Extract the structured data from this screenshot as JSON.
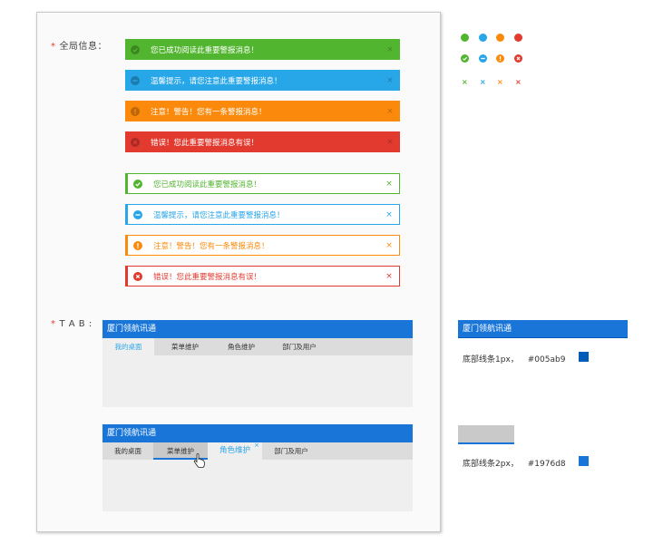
{
  "colors": {
    "success": "#52b52f",
    "info": "#27a6e8",
    "warning": "#fb8a0c",
    "error": "#e23a2f",
    "tab_accent": "#1976d8",
    "tab_underline": "#005ab9",
    "tab_active_text": "#2ea6e8"
  },
  "global_info": {
    "label": "全局信息：",
    "alerts": [
      {
        "type": "success",
        "text": "您已成功阅读此重要警报消息！",
        "icon": "check-circle-icon",
        "close": "×"
      },
      {
        "type": "info",
        "text": "温馨提示，请您注意此重要警报消息！",
        "icon": "minus-circle-icon",
        "close": "×"
      },
      {
        "type": "warning",
        "text": "注意！警告！您有一条警报消息！",
        "icon": "exclamation-circle-icon",
        "close": "×"
      },
      {
        "type": "error",
        "text": "错误！您此重要警报消息有误！",
        "icon": "x-circle-icon",
        "close": "×"
      }
    ]
  },
  "tab_section": {
    "label": "T A B :",
    "example1": {
      "title": "厦门领航讯通",
      "tabs": [
        "我的桌面",
        "菜单维护",
        "角色维护",
        "部门及用户"
      ],
      "active_index": 0
    },
    "example2": {
      "title": "厦门领航讯通",
      "tabs": [
        "我的桌面",
        "菜单维护",
        "角色维护",
        "部门及用户"
      ],
      "active_index": 2,
      "hover_index": 1,
      "close": "×"
    }
  },
  "legend": {
    "x_mark": "×",
    "title_sample": "厦门领航讯通",
    "note1_text": "底部线条1px，",
    "note1_hex": "#005ab9",
    "note2_text": "底部线条2px，",
    "note2_hex": "#1976d8"
  }
}
